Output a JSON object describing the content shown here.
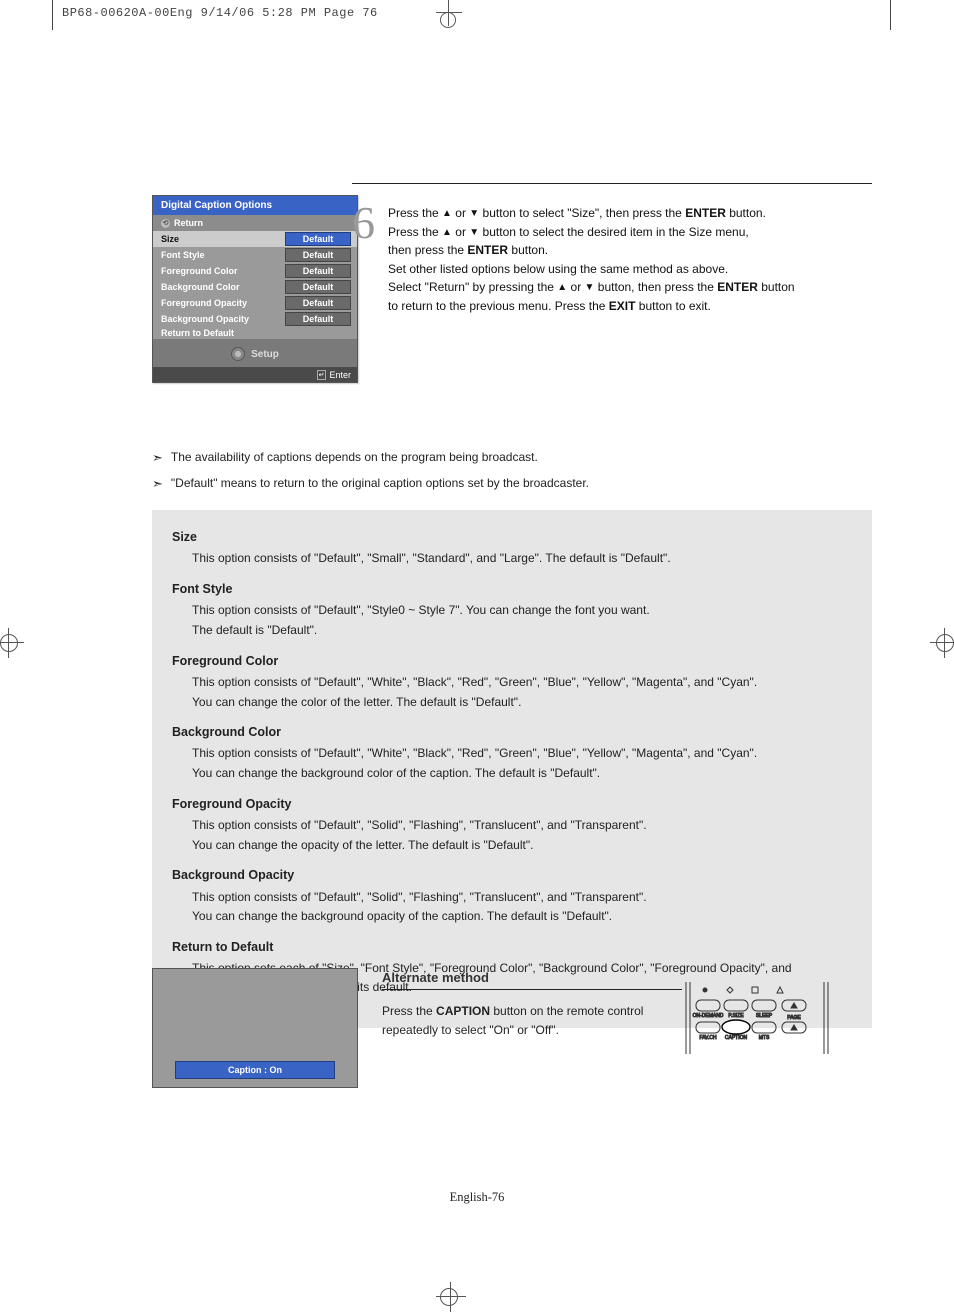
{
  "header": "BP68-00620A-00Eng  9/14/06  5:28 PM  Page 76",
  "osd": {
    "title": "Digital Caption Options",
    "return": "Return",
    "rows": [
      {
        "label": "Size",
        "value": "Default",
        "selected": true
      },
      {
        "label": "Font Style",
        "value": "Default",
        "selected": false
      },
      {
        "label": "Foreground Color",
        "value": "Default",
        "selected": false
      },
      {
        "label": "Background Color",
        "value": "Default",
        "selected": false
      },
      {
        "label": "Foreground Opacity",
        "value": "Default",
        "selected": false
      },
      {
        "label": "Background Opacity",
        "value": "Default",
        "selected": false
      },
      {
        "label": "Return to Default",
        "value": "",
        "selected": false
      }
    ],
    "setup": "Setup",
    "enter": "Enter"
  },
  "step": {
    "num": "6",
    "l1a": "Press the ",
    "l1b": " or ",
    "l1c": " button to select \"Size\", then press the ",
    "l1d": "ENTER",
    "l1e": " button.",
    "l2a": "Press the ",
    "l2b": " or ",
    "l2c": " button to select the desired item in the Size menu,",
    "l3a": "then press the ",
    "l3b": "ENTER",
    "l3c": " button.",
    "l4": "Set other listed options below using the same method as above.",
    "l5a": "Select \"Return\" by pressing the ",
    "l5b": " or ",
    "l5c": " button, then press the ",
    "l5d": "ENTER",
    "l5e": " button",
    "l6a": "to return to the previous menu. Press the ",
    "l6b": "EXIT",
    "l6c": " button to exit."
  },
  "notes": {
    "n1": "The availability of captions depends on the program being broadcast.",
    "n2": "\"Default\" means to return to the original caption options set by the broadcaster."
  },
  "options": [
    {
      "title": "Size",
      "lines": [
        "This option consists of \"Default\", \"Small\", \"Standard\", and \"Large\". The default is \"Default\"."
      ]
    },
    {
      "title": "Font Style",
      "lines": [
        "This option consists of \"Default\", \"Style0 ~ Style 7\". You can change the font you want.",
        "The default is \"Default\"."
      ]
    },
    {
      "title": "Foreground Color",
      "lines": [
        "This option consists of \"Default\", \"White\", \"Black\", \"Red\", \"Green\", \"Blue\", \"Yellow\", \"Magenta\", and \"Cyan\".",
        "You can change the color of the letter. The default is \"Default\"."
      ]
    },
    {
      "title": "Background Color",
      "lines": [
        "This option consists of \"Default\", \"White\", \"Black\", \"Red\", \"Green\", \"Blue\", \"Yellow\", \"Magenta\", and \"Cyan\".",
        "You can change the background color of the caption. The default is \"Default\"."
      ]
    },
    {
      "title": "Foreground Opacity",
      "lines": [
        "This option consists of \"Default\", \"Solid\", \"Flashing\", \"Translucent\", and \"Transparent\".",
        "You can change the opacity of the letter. The default is \"Default\"."
      ]
    },
    {
      "title": "Background Opacity",
      "lines": [
        "This option consists of \"Default\", \"Solid\", \"Flashing\", \"Translucent\", and \"Transparent\".",
        "You can change the background opacity of the caption. The default is \"Default\"."
      ]
    },
    {
      "title": "Return to Default",
      "lines": [
        "This option sets each of \"Size\", \"Font Style\", \"Foreground Color\", \"Background Color\", \"Foreground Opacity\", and \"Background Opacity\" Color to its default."
      ]
    }
  ],
  "alt": {
    "heading": "Alternate method",
    "l1a": "Press the ",
    "l1b": "CAPTION",
    "l1c": " button on the remote control repeatedly to select \"On\" or \"Off\"."
  },
  "tv_caption": "Caption : On",
  "remote_labels": {
    "ondemand": "ON-DEMAND",
    "psize": "P.SIZE",
    "sleep": "SLEEP",
    "favch": "FAV.CH",
    "caption": "CAPTION",
    "mts": "MTS",
    "page": "PAGE"
  },
  "footer": "English-76"
}
